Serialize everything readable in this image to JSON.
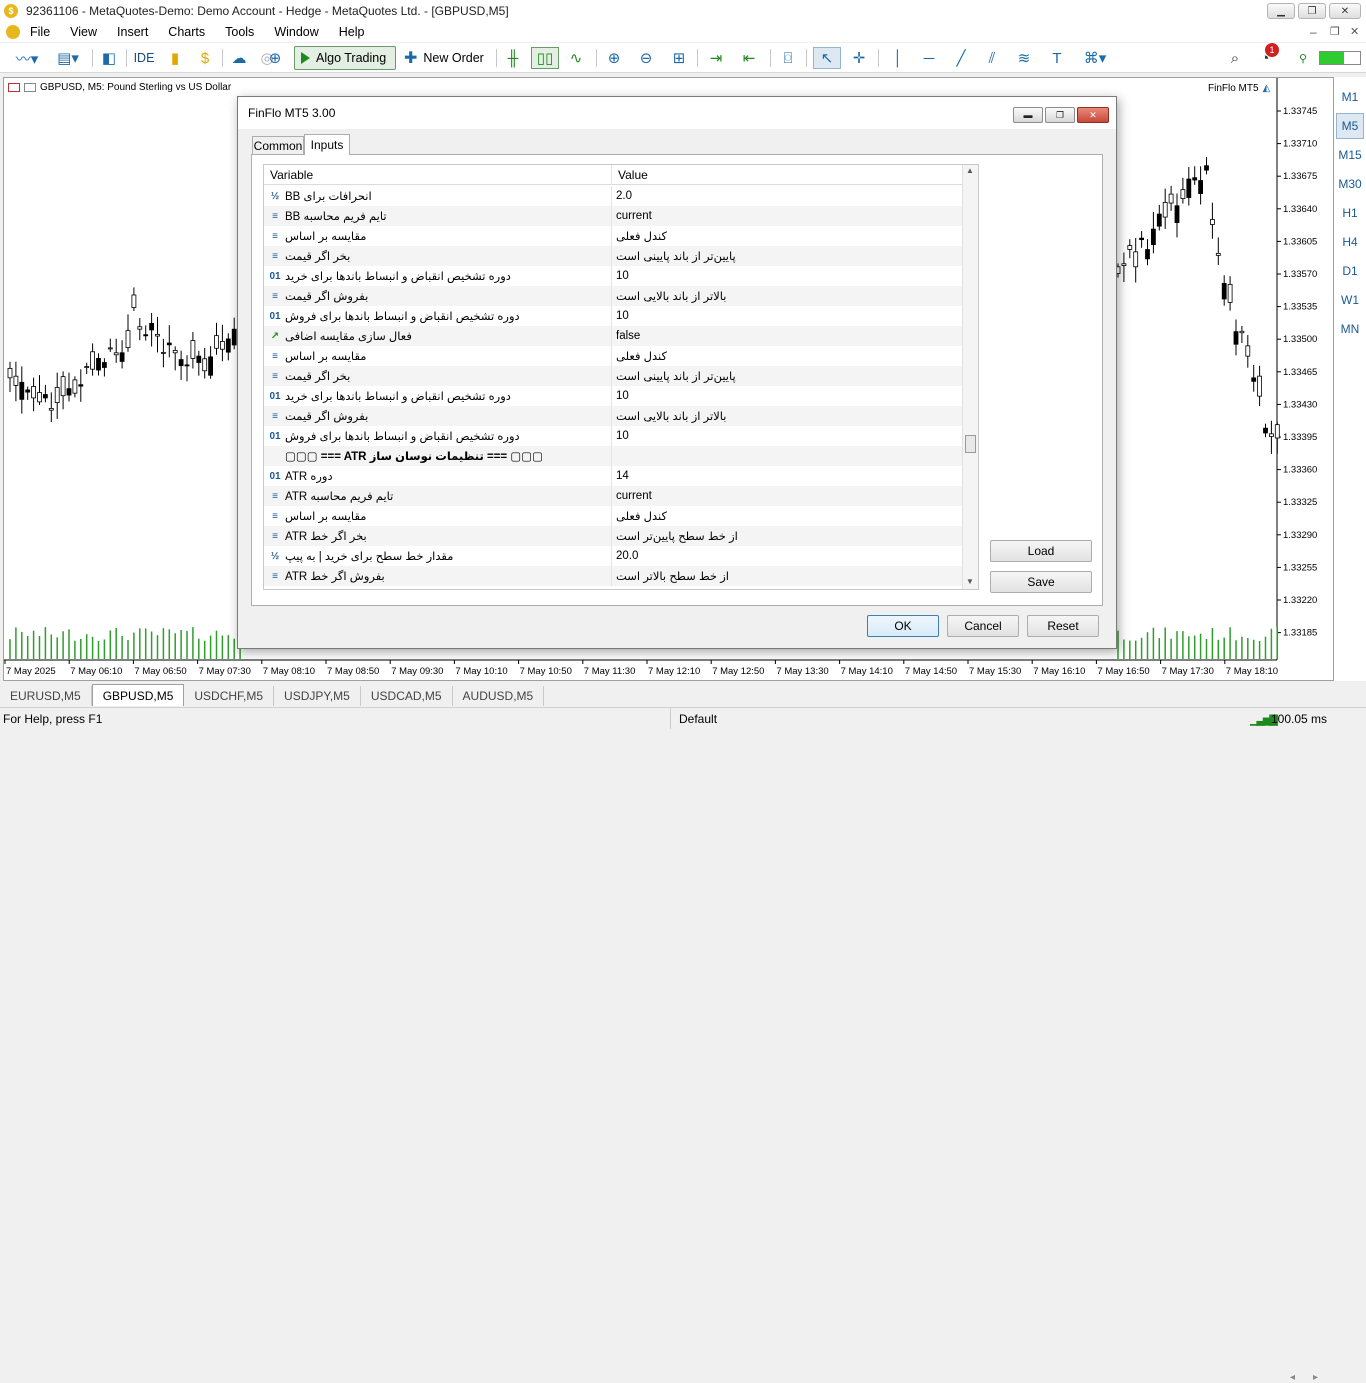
{
  "window": {
    "title": "92361106 - MetaQuotes-Demo: Demo Account - Hedge - MetaQuotes Ltd. - [GBPUSD,M5]"
  },
  "menu": [
    "File",
    "View",
    "Insert",
    "Charts",
    "Tools",
    "Window",
    "Help"
  ],
  "toolbar": {
    "ide": "IDE",
    "algo_trading": "Algo Trading",
    "new_order": "New Order",
    "notif_count": "1"
  },
  "chart": {
    "title": "GBPUSD, M5:  Pound Sterling vs US Dollar",
    "indicator_label": "FinFlo MT5",
    "price_labels": [
      "1.33745",
      "1.33710",
      "1.33675",
      "1.33640",
      "1.33605",
      "1.33570",
      "1.33535",
      "1.33500",
      "1.33465",
      "1.33430",
      "1.33395",
      "1.33360",
      "1.33325",
      "1.33290",
      "1.33255",
      "1.33220",
      "1.33185"
    ],
    "time_labels": [
      "7 May 2025",
      "7 May 06:10",
      "7 May 06:50",
      "7 May 07:30",
      "7 May 08:10",
      "7 May 08:50",
      "7 May 09:30",
      "7 May 10:10",
      "7 May 10:50",
      "7 May 11:30",
      "7 May 12:10",
      "7 May 12:50",
      "7 May 13:30",
      "7 May 14:10",
      "7 May 14:50",
      "7 May 15:30",
      "7 May 16:10",
      "7 May 16:50",
      "7 May 17:30",
      "7 May 18:10"
    ]
  },
  "timeframes": [
    "M1",
    "M5",
    "M15",
    "M30",
    "H1",
    "H4",
    "D1",
    "W1",
    "MN"
  ],
  "active_timeframe": "M5",
  "chart_tabs": [
    "EURUSD,M5",
    "GBPUSD,M5",
    "USDCHF,M5",
    "USDJPY,M5",
    "USDCAD,M5",
    "AUDUSD,M5"
  ],
  "active_chart_tab": "GBPUSD,M5",
  "status": {
    "help": "For Help, press F1",
    "profile": "Default",
    "ping": "100.05 ms"
  },
  "dialog": {
    "title": "FinFlo MT5 3.00",
    "tabs": [
      "Common",
      "Inputs"
    ],
    "active_tab": "Inputs",
    "columns": {
      "variable": "Variable",
      "value": "Value"
    },
    "rows": [
      {
        "icon": "½",
        "variable": "انحرافات برای BB",
        "value": "2.0"
      },
      {
        "icon": "≡",
        "variable": "تایم فریم محاسبه BB",
        "value": "current"
      },
      {
        "icon": "≡",
        "variable": "مقایسه بر اساس",
        "value": "کندل فعلی"
      },
      {
        "icon": "≡",
        "variable": "بخر اگر قیمت",
        "value": "پایین‌تر از باند پایینی  است"
      },
      {
        "icon": "01",
        "variable": "دوره تشخیص انقباض و انبساط باندها برای خرید",
        "value": "10"
      },
      {
        "icon": "≡",
        "variable": "بفروش اگر قیمت",
        "value": "بالاتر از باند بالایی است"
      },
      {
        "icon": "01",
        "variable": "دوره تشخیص انقباض و انبساط باندها برای فروش",
        "value": "10"
      },
      {
        "icon": "↗",
        "variable": "فعال سازی مقایسه اضافی",
        "value": "false"
      },
      {
        "icon": "≡",
        "variable": "مقایسه بر اساس",
        "value": "کندل فعلی"
      },
      {
        "icon": "≡",
        "variable": "بخر اگر قیمت",
        "value": "پایین‌تر از باند پایینی  است"
      },
      {
        "icon": "01",
        "variable": "دوره تشخیص انقباض و انبساط باندها برای خرید",
        "value": "10"
      },
      {
        "icon": "≡",
        "variable": "بفروش اگر قیمت",
        "value": "بالاتر از باند بالایی است"
      },
      {
        "icon": "01",
        "variable": "دوره تشخیص انقباض و انبساط باندها برای فروش",
        "value": "10"
      },
      {
        "icon": "",
        "variable": "▢▢▢ === ATR تنظیمات نوسان ساز === ▢▢▢",
        "value": ""
      },
      {
        "icon": "01",
        "variable": "دوره ATR",
        "value": "14"
      },
      {
        "icon": "≡",
        "variable": "تایم فریم محاسبه ATR",
        "value": "current"
      },
      {
        "icon": "≡",
        "variable": "مقایسه بر اساس",
        "value": "کندل فعلی"
      },
      {
        "icon": "≡",
        "variable": "بخر اگر خط ATR",
        "value": "از خط سطح پایین‌تر است"
      },
      {
        "icon": "½",
        "variable": "مقدار خط سطح برای خرید | به پیپ",
        "value": "20.0"
      },
      {
        "icon": "≡",
        "variable": "بفروش اگر خط ATR",
        "value": "از خط سطح بالاتر است"
      }
    ],
    "buttons": {
      "load": "Load",
      "save": "Save",
      "ok": "OK",
      "cancel": "Cancel",
      "reset": "Reset"
    }
  }
}
